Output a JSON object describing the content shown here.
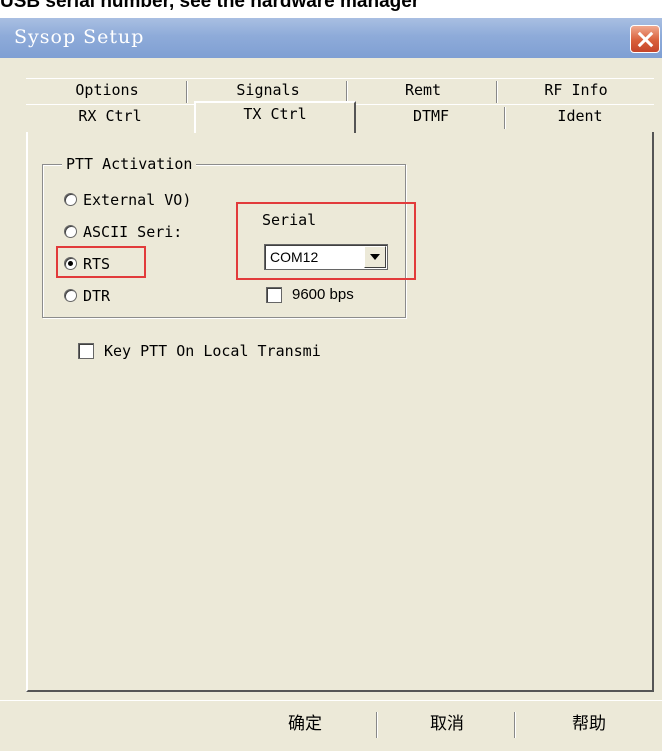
{
  "caption": "USB serial number, see the hardware manager",
  "window": {
    "title": "Sysop Setup"
  },
  "tabs": {
    "row1": [
      "Options",
      "Signals",
      "Remt",
      "RF Info"
    ],
    "row2": [
      "RX Ctrl",
      "TX Ctrl",
      "DTMF",
      "Ident"
    ],
    "active": "TX Ctrl"
  },
  "ptt": {
    "group_label": "PTT Activation",
    "options": [
      "External VO)",
      "ASCII Seri:",
      "RTS",
      "DTR"
    ],
    "selected": "RTS",
    "serial_label": "Serial",
    "port_value": "COM12",
    "baud_label": "9600 bps",
    "baud_checked": false
  },
  "key_ptt": {
    "label": "Key PTT On Local Transmi",
    "checked": false
  },
  "buttons": {
    "ok": "确定",
    "cancel": "取消",
    "help": "帮助"
  },
  "colors": {
    "highlight": "#e23b3b",
    "titlebar": "#8eabd9",
    "dialog": "#ece9d8"
  }
}
